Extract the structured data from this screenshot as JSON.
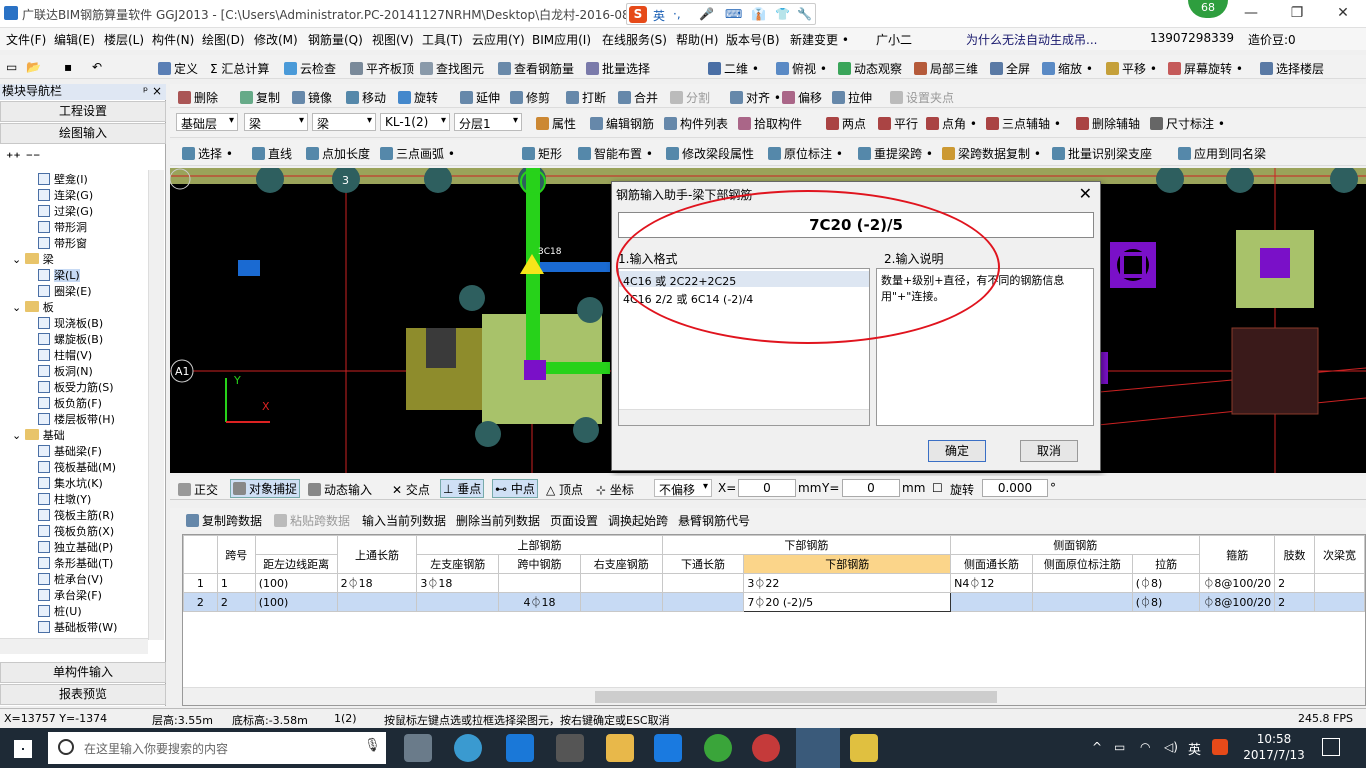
{
  "window": {
    "title": "广联达BIM钢筋算量软件 GGJ2013 - [C:\\Users\\Administrator.PC-20141127NRHM\\Desktop\\白龙村-2016-08-",
    "badge": "68",
    "controls": {
      "minimize": "—",
      "maximize": "❐",
      "close": "✕"
    }
  },
  "ime": {
    "label": "英",
    "items": [
      "·,",
      "🎤",
      "⌨",
      "👔",
      "👕",
      "🔧"
    ]
  },
  "menu": {
    "items": [
      "文件(F)",
      "编辑(E)",
      "楼层(L)",
      "构件(N)",
      "绘图(D)",
      "修改(M)",
      "钢筋量(Q)",
      "视图(V)",
      "工具(T)",
      "云应用(Y)",
      "BIM应用(I)",
      "在线服务(S)",
      "帮助(H)",
      "版本号(B)",
      "新建变更 •",
      "广小二"
    ],
    "question": "为什么无法自动生成吊...",
    "phone": "13907298339",
    "price": "造价豆:0"
  },
  "toolbar1": {
    "items": [
      "定义",
      "汇总计算",
      "云检查",
      "平齐板顶",
      "查找图元",
      "查看钢筋量",
      "批量选择",
      "二维 •",
      "俯视 •",
      "动态观察",
      "局部三维",
      "全屏",
      "缩放 •",
      "平移 •",
      "屏幕旋转 •",
      "选择楼层"
    ]
  },
  "toolbar2": {
    "items": [
      "删除",
      "复制",
      "镜像",
      "移动",
      "旋转",
      "延伸",
      "修剪",
      "打断",
      "合并",
      "分割",
      "对齐 •",
      "偏移",
      "拉伸",
      "设置夹点"
    ]
  },
  "toolbar3": {
    "selects": [
      "基础层",
      "梁",
      "梁",
      "KL-1(2)",
      "分层1"
    ],
    "items": [
      "属性",
      "编辑钢筋",
      "构件列表",
      "拾取构件",
      "两点",
      "平行",
      "点角 •",
      "三点辅轴 •",
      "删除辅轴",
      "尺寸标注 •"
    ]
  },
  "toolbar4": {
    "items": [
      "选择 •",
      "直线",
      "点加长度",
      "三点画弧 •",
      "矩形",
      "智能布置 •",
      "修改梁段属性",
      "原位标注 •",
      "重提梁跨 •",
      "梁跨数据复制 •",
      "批量识别梁支座",
      "应用到同名梁"
    ]
  },
  "nav": {
    "header": "模块导航栏",
    "pin": "ᵖ ×",
    "btn_project": "工程设置",
    "btn_draw": "绘图输入",
    "btn_single": "单构件输入",
    "btn_report": "报表预览",
    "tree": [
      {
        "label": "壁龛(I)",
        "depth": 2
      },
      {
        "label": "连梁(G)",
        "depth": 2
      },
      {
        "label": "过梁(G)",
        "depth": 2
      },
      {
        "label": "带形洞",
        "depth": 2
      },
      {
        "label": "带形窗",
        "depth": 2
      },
      {
        "label": "梁",
        "depth": 1
      },
      {
        "label": "梁(L)",
        "depth": 2
      },
      {
        "label": "圈梁(E)",
        "depth": 2
      },
      {
        "label": "板",
        "depth": 1
      },
      {
        "label": "现浇板(B)",
        "depth": 2
      },
      {
        "label": "螺旋板(B)",
        "depth": 2
      },
      {
        "label": "柱帽(V)",
        "depth": 2
      },
      {
        "label": "板洞(N)",
        "depth": 2
      },
      {
        "label": "板受力筋(S)",
        "depth": 2
      },
      {
        "label": "板负筋(F)",
        "depth": 2
      },
      {
        "label": "楼层板带(H)",
        "depth": 2
      },
      {
        "label": "基础",
        "depth": 1
      },
      {
        "label": "基础梁(F)",
        "depth": 2
      },
      {
        "label": "筏板基础(M)",
        "depth": 2
      },
      {
        "label": "集水坑(K)",
        "depth": 2
      },
      {
        "label": "柱墩(Y)",
        "depth": 2
      },
      {
        "label": "筏板主筋(R)",
        "depth": 2
      },
      {
        "label": "筏板负筋(X)",
        "depth": 2
      },
      {
        "label": "独立基础(P)",
        "depth": 2
      },
      {
        "label": "条形基础(T)",
        "depth": 2
      },
      {
        "label": "桩承台(V)",
        "depth": 2
      },
      {
        "label": "承台梁(F)",
        "depth": 2
      },
      {
        "label": "桩(U)",
        "depth": 2
      },
      {
        "label": "基础板带(W)",
        "depth": 2
      }
    ]
  },
  "canvas": {
    "axis_labels": [
      "A1",
      "3"
    ],
    "rebar_label": "3C18",
    "ucs": {
      "x": "X",
      "y": "Y"
    }
  },
  "dialog": {
    "title": "钢筋输入助手-梁下部钢筋",
    "formula": "7C20 (-2)/5",
    "format_label": "1.输入格式",
    "desc_label": "2.输入说明",
    "formats": [
      "4C16 或 2C22+2C25",
      "4C16 2/2 或 6C14 (-2)/4"
    ],
    "description": "数量+级别+直径，有不同的钢筋信息用\"+\"连接。",
    "ok": "确定",
    "cancel": "取消"
  },
  "snapbar": {
    "items": [
      "正交",
      "对象捕捉",
      "动态输入",
      "交点",
      "垂点",
      "中点",
      "顶点",
      "坐标"
    ],
    "offset_mode": "不偏移",
    "x_label": "X=",
    "x_value": "0",
    "y_label": "Y=",
    "y_value": "0",
    "unit": "mm",
    "rotate_label": "旋转",
    "rotate_value": "0.000",
    "degree": "°"
  },
  "gridbar": {
    "items": [
      "复制跨数据",
      "粘贴跨数据",
      "输入当前列数据",
      "删除当前列数据",
      "页面设置",
      "调换起始跨",
      "悬臂钢筋代号"
    ]
  },
  "grid": {
    "group_headers": {
      "top": "上部钢筋",
      "bottom": "下部钢筋",
      "side": "侧面钢筋"
    },
    "headers": [
      "跨号",
      "距左边线距离",
      "上通长筋",
      "左支座钢筋",
      "跨中钢筋",
      "右支座钢筋",
      "下通长筋",
      "下部钢筋",
      "侧面通长筋",
      "侧面原位标注筋",
      "拉筋",
      "箍筋",
      "肢数",
      "次梁宽"
    ],
    "rows": [
      {
        "idx": "1",
        "span": "1",
        "dist": "(100)",
        "top_long": "2⏀18",
        "left_sup": "3⏀18",
        "mid": "",
        "right_sup": "",
        "bot_long": "",
        "bottom": "3⏀22",
        "side_long": "N4⏀12",
        "side_in": "",
        "tie": "(⏀8)",
        "stirrup": "⏀8@100/20",
        "legs": "2"
      },
      {
        "idx": "2",
        "span": "2",
        "dist": "(100)",
        "top_long": "",
        "left_sup": "",
        "mid": "4⏀18",
        "right_sup": "",
        "bot_long": "",
        "bottom": "7⏀20 (-2)/5",
        "side_long": "",
        "side_in": "",
        "tie": "(⏀8)",
        "stirrup": "⏀8@100/20",
        "legs": "2"
      }
    ]
  },
  "status": {
    "coords": "X=13757 Y=-1374",
    "floor_height": "层高:3.55m",
    "bottom_height": "底标高:-3.58m",
    "count": "1(2)",
    "hint": "按鼠标左键点选或拉框选择梁图元，按右键确定或ESC取消",
    "fps": "245.8 FPS"
  },
  "taskbar": {
    "search_placeholder": "在这里输入你要搜索的内容",
    "time": "10:58",
    "date": "2017/7/13",
    "lang": "英"
  },
  "colors": {
    "accent": "#2a72c5",
    "ellipse": "#e0141e",
    "beam": "#27d21a",
    "column": "#2e5f5f"
  }
}
